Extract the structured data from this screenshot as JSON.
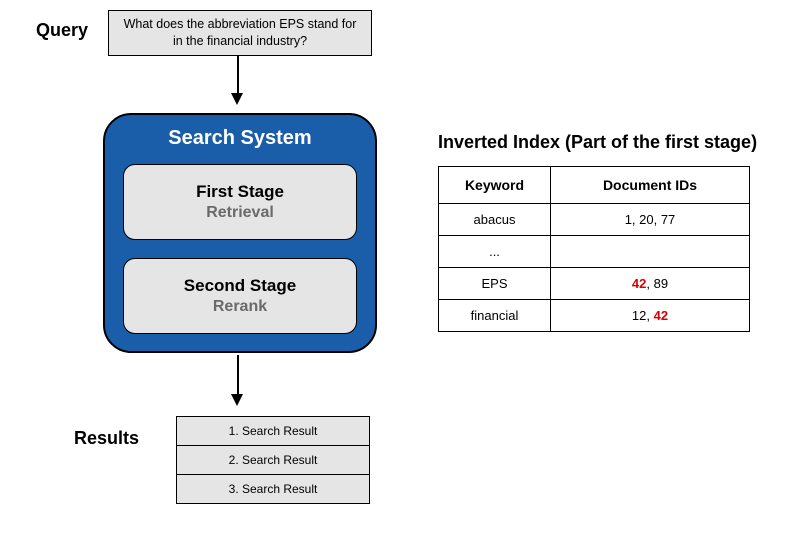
{
  "query": {
    "label": "Query",
    "text": "What does the abbreviation EPS stand for in the financial industry?"
  },
  "search_system": {
    "title": "Search System",
    "stage1": {
      "title": "First Stage",
      "sub": "Retrieval"
    },
    "stage2": {
      "title": "Second Stage",
      "sub": "Rerank"
    }
  },
  "results": {
    "label": "Results",
    "items": [
      "1. Search Result",
      "2. Search Result",
      "3. Search Result"
    ]
  },
  "index": {
    "title": "Inverted Index (Part of the first stage)",
    "headers": {
      "keyword": "Keyword",
      "doc_ids": "Document IDs"
    },
    "rows": [
      {
        "keyword": "abacus",
        "doc_ids_parts": [
          {
            "t": "1, 20, 77",
            "hl": false
          }
        ]
      },
      {
        "keyword": "...",
        "doc_ids_parts": []
      },
      {
        "keyword": "EPS",
        "doc_ids_parts": [
          {
            "t": "42",
            "hl": true
          },
          {
            "t": ", 89",
            "hl": false
          }
        ]
      },
      {
        "keyword": "financial",
        "doc_ids_parts": [
          {
            "t": "12, ",
            "hl": false
          },
          {
            "t": "42",
            "hl": true
          }
        ]
      }
    ]
  }
}
